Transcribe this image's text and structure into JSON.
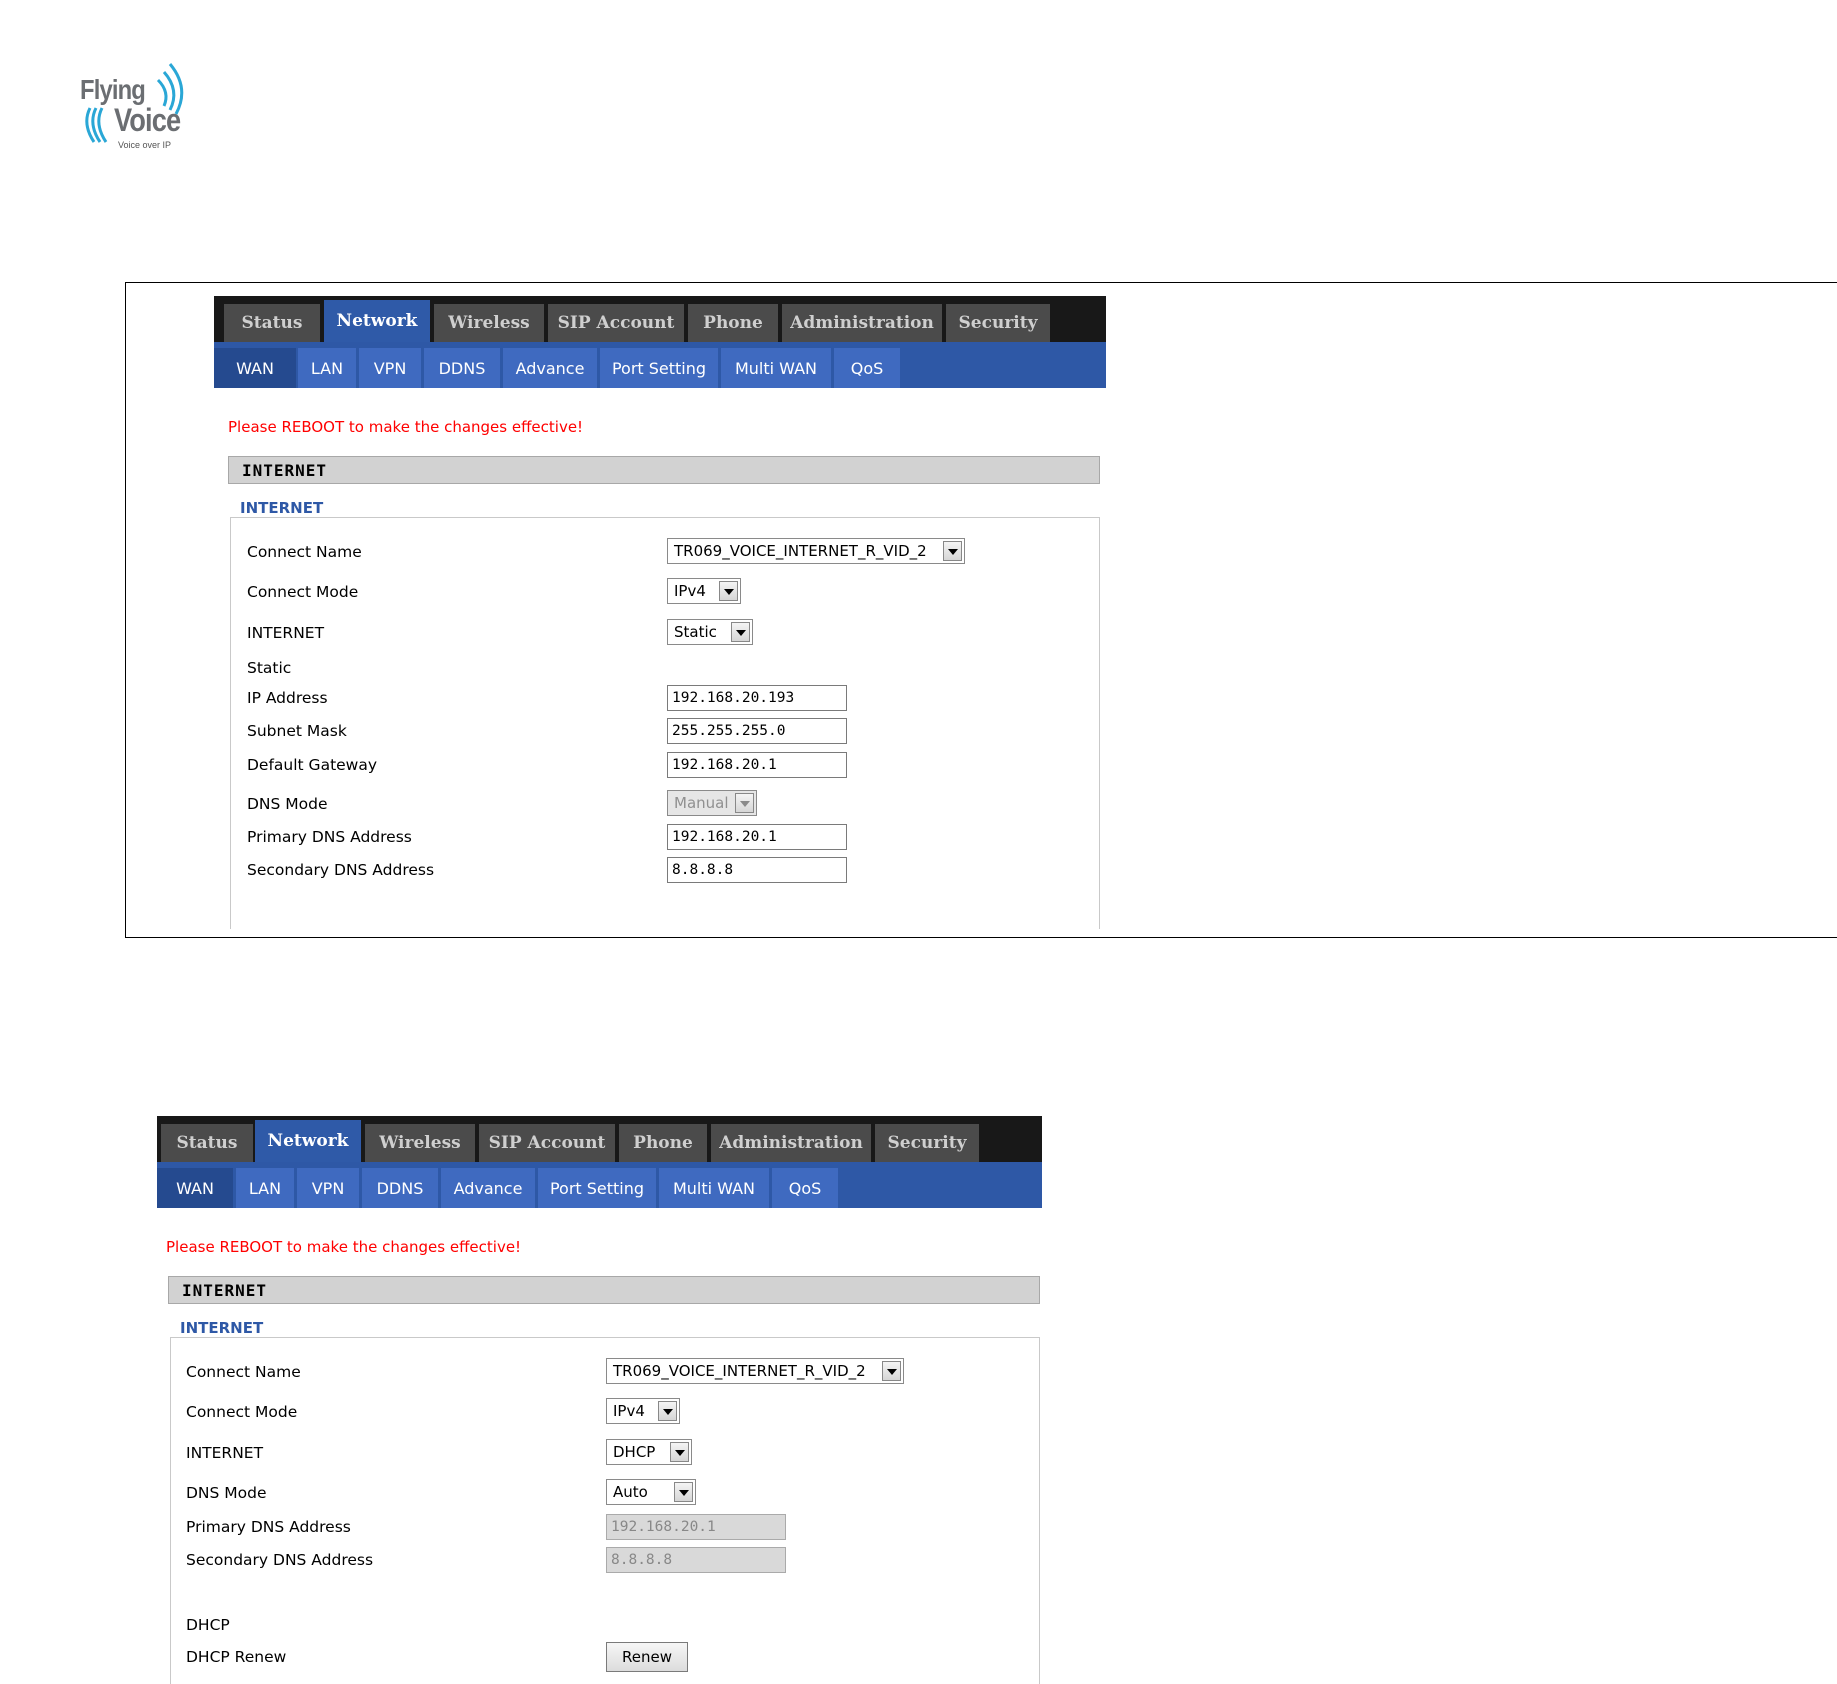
{
  "logo": {
    "line1": "Flying",
    "line2": "Voice",
    "tagline": "Voice over IP"
  },
  "tabs": [
    "Status",
    "Network",
    "Wireless",
    "SIP Account",
    "Phone",
    "Administration",
    "Security"
  ],
  "subtabs": [
    "WAN",
    "LAN",
    "VPN",
    "DDNS",
    "Advance",
    "Port Setting",
    "Multi WAN",
    "QoS"
  ],
  "screen1": {
    "notice": "Please REBOOT to make the changes effective!",
    "section_title": "INTERNET",
    "legend": "INTERNET",
    "connect_name_label": "Connect Name",
    "connect_name_value": "TR069_VOICE_INTERNET_R_VID_2",
    "connect_mode_label": "Connect Mode",
    "connect_mode_value": "IPv4",
    "internet_label": "INTERNET",
    "internet_value": "Static",
    "static_label": "Static",
    "ip_label": "IP Address",
    "ip_value": "192.168.20.193",
    "mask_label": "Subnet Mask",
    "mask_value": "255.255.255.0",
    "gateway_label": "Default Gateway",
    "gateway_value": "192.168.20.1",
    "dns_mode_label": "DNS Mode",
    "dns_mode_value": "Manual",
    "primary_dns_label": "Primary DNS Address",
    "primary_dns_value": "192.168.20.1",
    "secondary_dns_label": "Secondary DNS Address",
    "secondary_dns_value": "8.8.8.8"
  },
  "screen2": {
    "notice": "Please REBOOT to make the changes effective!",
    "section_title": "INTERNET",
    "legend": "INTERNET",
    "connect_name_label": "Connect Name",
    "connect_name_value": "TR069_VOICE_INTERNET_R_VID_2",
    "connect_mode_label": "Connect Mode",
    "connect_mode_value": "IPv4",
    "internet_label": "INTERNET",
    "internet_value": "DHCP",
    "dns_mode_label": "DNS Mode",
    "dns_mode_value": "Auto",
    "primary_dns_label": "Primary DNS Address",
    "primary_dns_value": "192.168.20.1",
    "secondary_dns_label": "Secondary DNS Address",
    "secondary_dns_value": "8.8.8.8",
    "dhcp_label": "DHCP",
    "dhcp_renew_label": "DHCP Renew",
    "renew_button": "Renew"
  }
}
